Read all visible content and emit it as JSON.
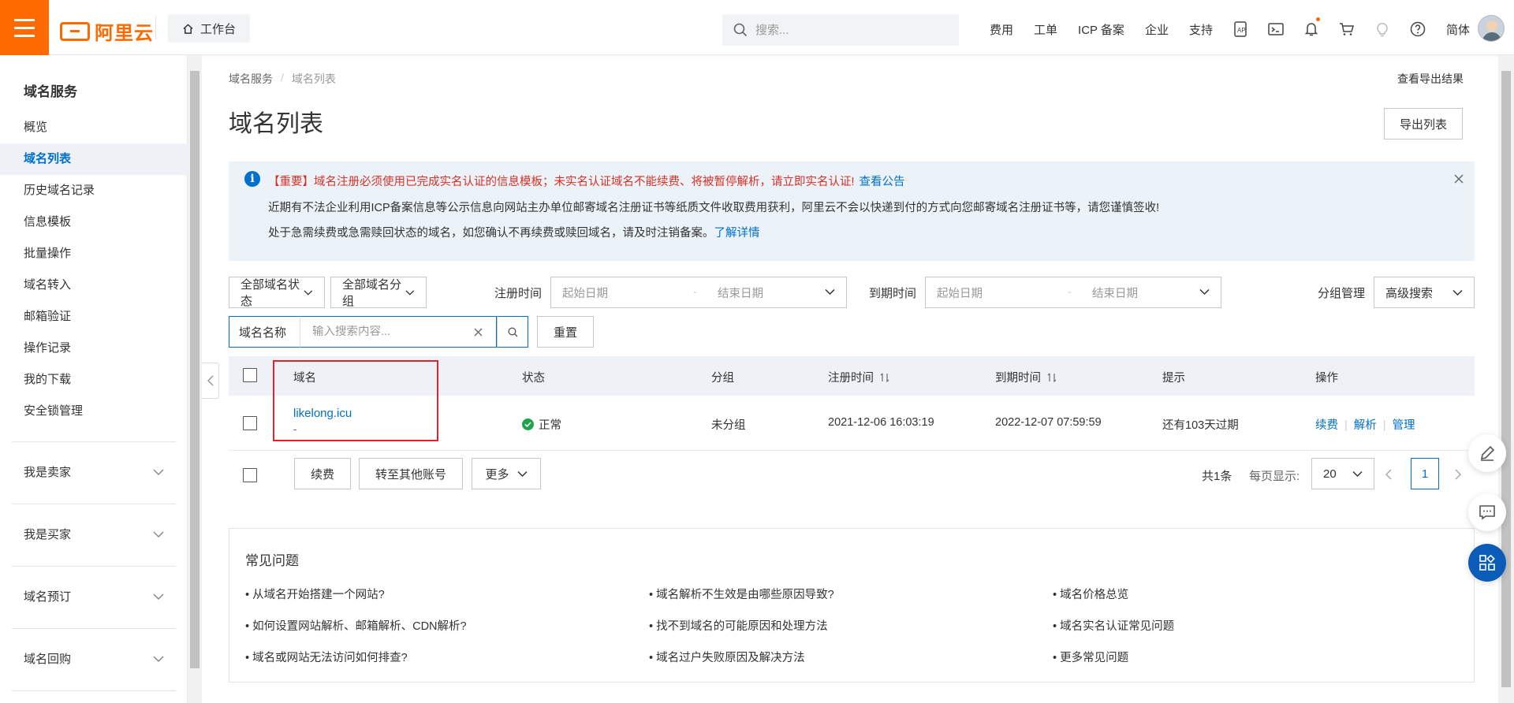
{
  "header": {
    "logo_text": "阿里云",
    "workbench_label": "工作台",
    "search_placeholder": "搜索...",
    "nav": [
      "费用",
      "工单",
      "ICP 备案",
      "企业",
      "支持"
    ],
    "lang": "简体",
    "icons": [
      "api-icon",
      "terminal-icon",
      "bell-icon",
      "cart-icon",
      "lightbulb-icon",
      "help-icon"
    ]
  },
  "sidebar": {
    "title": "域名服务",
    "items": [
      {
        "label": "概览",
        "active": false
      },
      {
        "label": "域名列表",
        "active": true
      },
      {
        "label": "历史域名记录",
        "active": false
      },
      {
        "label": "信息模板",
        "active": false
      },
      {
        "label": "批量操作",
        "active": false
      },
      {
        "label": "域名转入",
        "active": false
      },
      {
        "label": "邮箱验证",
        "active": false
      },
      {
        "label": "操作记录",
        "active": false
      },
      {
        "label": "我的下载",
        "active": false
      },
      {
        "label": "安全锁管理",
        "active": false
      }
    ],
    "groups": [
      "我是卖家",
      "我是买家",
      "域名预订",
      "域名回购"
    ]
  },
  "main": {
    "breadcrumb": [
      "域名服务",
      "域名列表"
    ],
    "export_result_link": "查看导出结果",
    "title": "域名列表",
    "export_button": "导出列表",
    "notice": {
      "line1": "【重要】域名注册必须使用已完成实名认证的信息模板；未实名认证域名不能续费、将被暂停解析，请立即实名认证!",
      "line1_link": "查看公告",
      "line2": "近期有不法企业利用ICP备案信息等公示信息向网站主办单位邮寄域名注册证书等纸质文件收取费用获利，阿里云不会以快递到付的方式向您邮寄域名注册证书等，请您谨慎签收!",
      "line3": "处于急需续费或急需赎回状态的域名，如您确认不再续费或赎回域名，请及时注销备案。",
      "line3_link": "了解详情"
    },
    "filters": {
      "status": "全部域名状态",
      "group": "全部域名分组",
      "reg_label": "注册时间",
      "exp_label": "到期时间",
      "start_placeholder": "起始日期",
      "end_placeholder": "结束日期",
      "dash": "-",
      "group_manage": "分组管理",
      "advanced": "高级搜索",
      "search_field": "域名名称",
      "search_placeholder": "输入搜索内容...",
      "reset": "重置"
    },
    "table": {
      "headers": [
        "域名",
        "状态",
        "分组",
        "注册时间",
        "到期时间",
        "提示",
        "操作"
      ],
      "rows": [
        {
          "domain": "likelong.icu",
          "sub": "-",
          "status": "正常",
          "group": "未分组",
          "reg_time": "2021-12-06 16:03:19",
          "exp_time": "2022-12-07 07:59:59",
          "hint": "还有103天过期",
          "ops": [
            "续费",
            "解析",
            "管理"
          ]
        }
      ]
    },
    "footer": {
      "renew": "续费",
      "transfer": "转至其他账号",
      "more": "更多",
      "total": "共1条",
      "per_page_label": "每页显示:",
      "per_page": "20",
      "current_page": "1"
    },
    "faq": {
      "title": "常见问题",
      "items": [
        "从域名开始搭建一个网站?",
        "域名解析不生效是由哪些原因导致?",
        "域名价格总览",
        "如何设置网站解析、邮箱解析、CDN解析?",
        "找不到域名的可能原因和处理方法",
        "域名实名认证常见问题",
        "域名或网站无法访问如何排查?",
        "域名过户失败原因及解决方法",
        "更多常见问题"
      ]
    }
  },
  "colors": {
    "brand": "#ff6a00",
    "link": "#0070cc",
    "warning_text": "#d93026",
    "success": "#1fa44a",
    "highlight_box": "#e0242b"
  }
}
